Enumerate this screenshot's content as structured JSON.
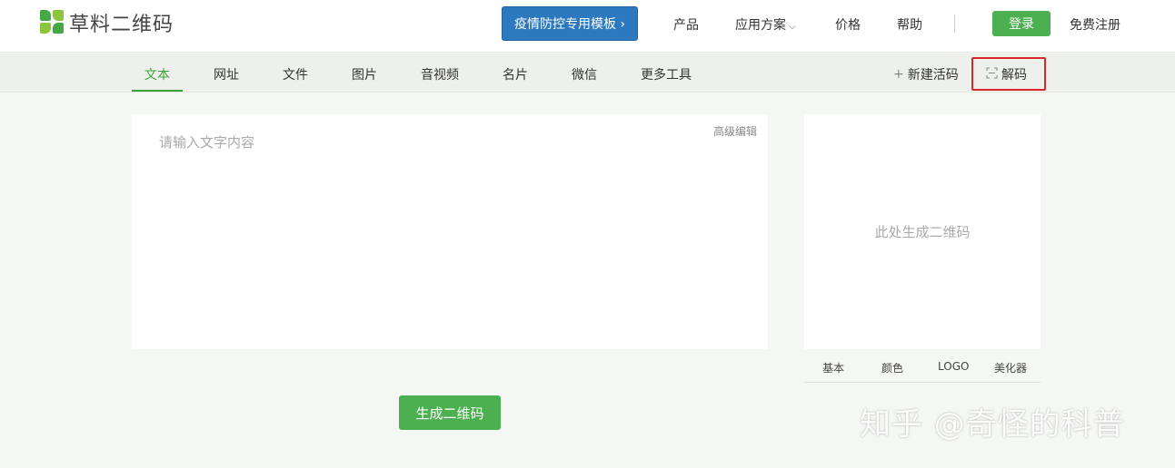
{
  "header": {
    "logo_text": "草料二维码",
    "promo_button": "疫情防控专用模板 ›",
    "nav": {
      "products": "产品",
      "solutions": "应用方案",
      "pricing": "价格",
      "help": "帮助"
    },
    "login": "登录",
    "register": "免费注册"
  },
  "tabs": {
    "text": "文本",
    "url": "网址",
    "file": "文件",
    "image": "图片",
    "av": "音视频",
    "card": "名片",
    "wechat": "微信",
    "more": "更多工具"
  },
  "tools": {
    "new_live_code": "新建活码",
    "decode": "解码"
  },
  "editor": {
    "placeholder": "请输入文字内容",
    "value": "",
    "advanced_edit": "高级编辑"
  },
  "preview": {
    "placeholder": "此处生成二维码",
    "tabs": {
      "basic": "基本",
      "color": "颜色",
      "logo": "LOGO",
      "beautify": "美化器"
    }
  },
  "generate_button": "生成二维码",
  "watermark": "知乎 @奇怪的科普",
  "colors": {
    "brand_green": "#4caf50",
    "promo_blue": "#2d79c0",
    "highlight_red": "#d9262b"
  }
}
